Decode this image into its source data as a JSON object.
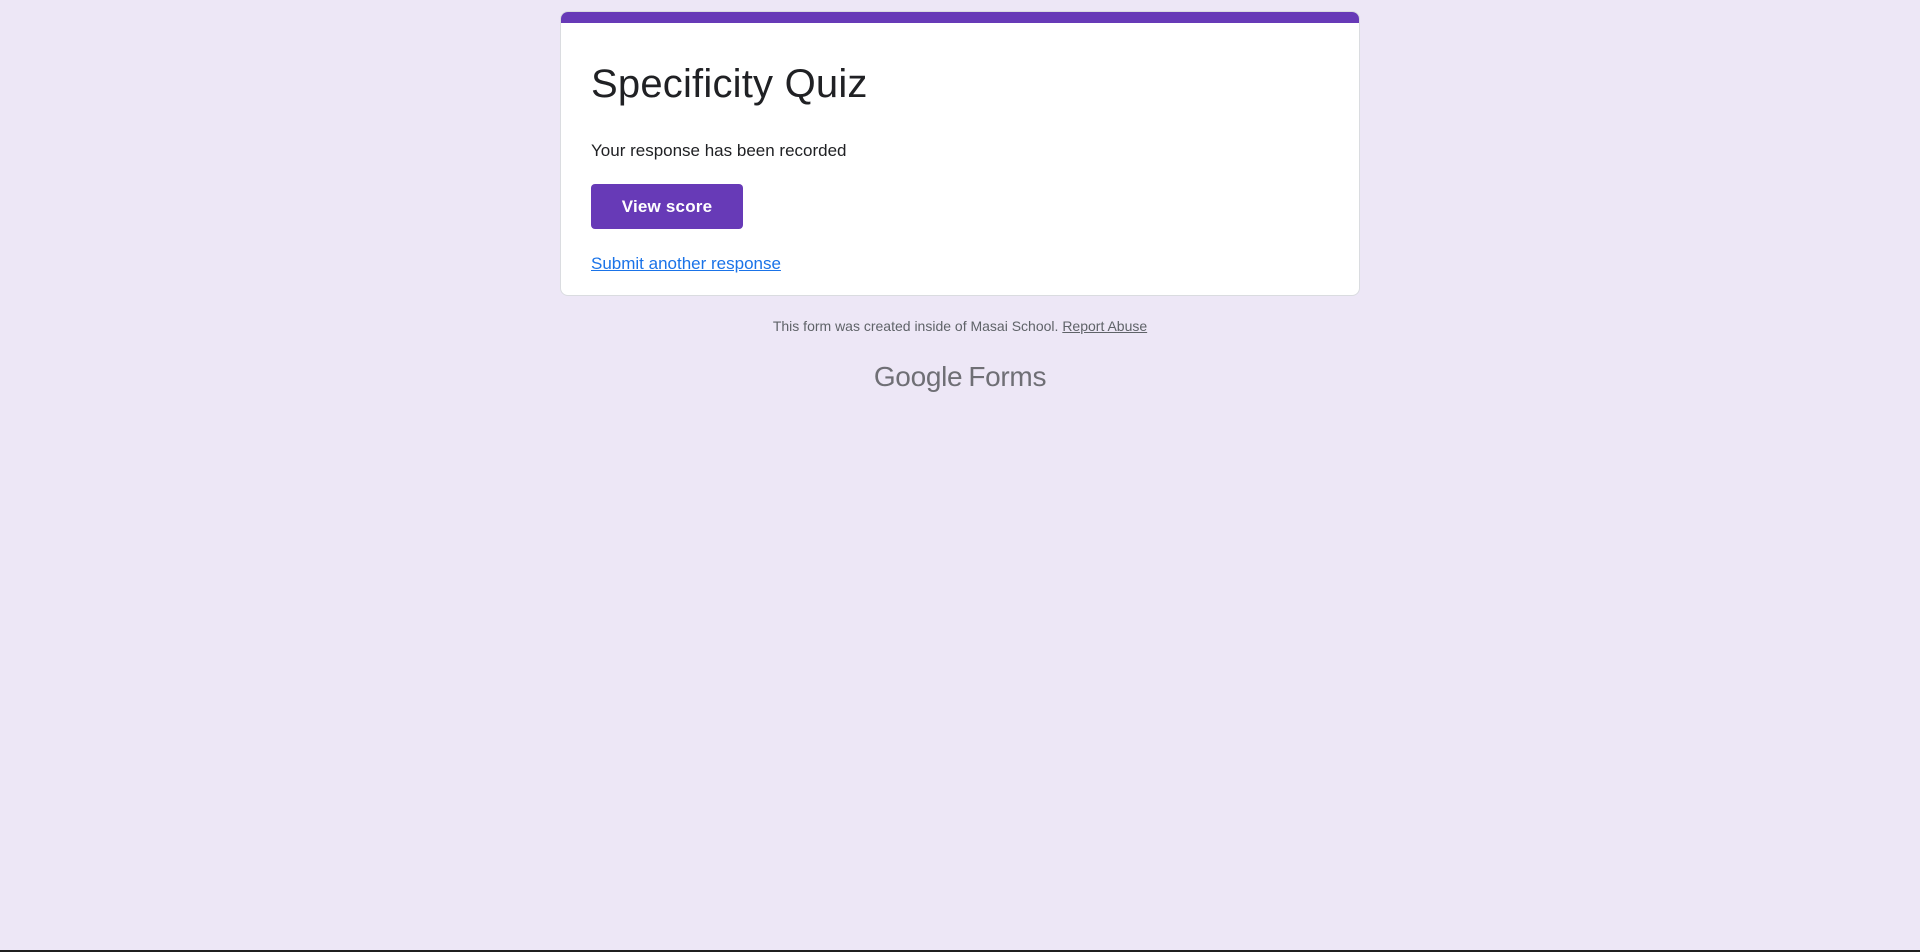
{
  "theme": {
    "accent_color": "#673ab7",
    "background_color": "#ede7f6",
    "link_color": "#1a73e8"
  },
  "card": {
    "title": "Specificity Quiz",
    "message": "Your response has been recorded",
    "view_score_label": "View score",
    "submit_another_label": "Submit another response"
  },
  "footer": {
    "note_text": "This form was created inside of Masai School.",
    "report_abuse_label": "Report Abuse"
  },
  "brand": {
    "google_text": "Google",
    "product_text": "Forms"
  }
}
